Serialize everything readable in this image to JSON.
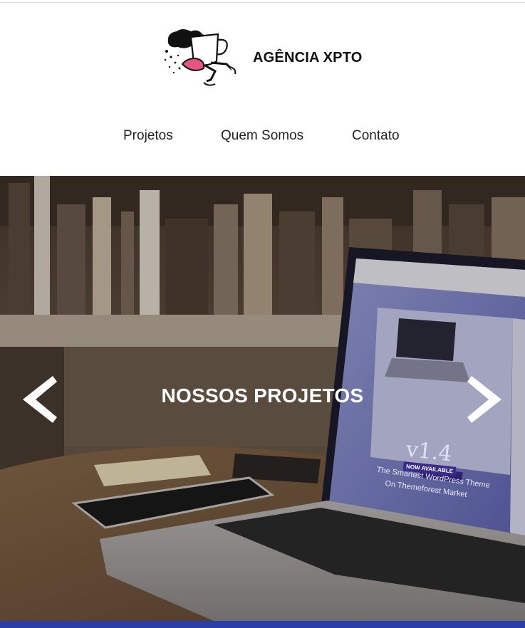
{
  "site": {
    "brand": "AGÊNCIA XPTO"
  },
  "nav": {
    "items": [
      {
        "label": "Projetos"
      },
      {
        "label": "Quem Somos"
      },
      {
        "label": "Contato"
      }
    ]
  },
  "hero": {
    "title": "NOSSOS PROJETOS",
    "screen": {
      "version": "v1.4",
      "badge": "NOW AVAILABLE",
      "tagline_line1": "The Smartest WordPress Theme",
      "tagline_line2": "On Themeforest Market"
    }
  },
  "colors": {
    "bottom_bar": "#2b3ea8",
    "screen_bg": "#6f74bd",
    "badge": "#3a2a8a"
  }
}
